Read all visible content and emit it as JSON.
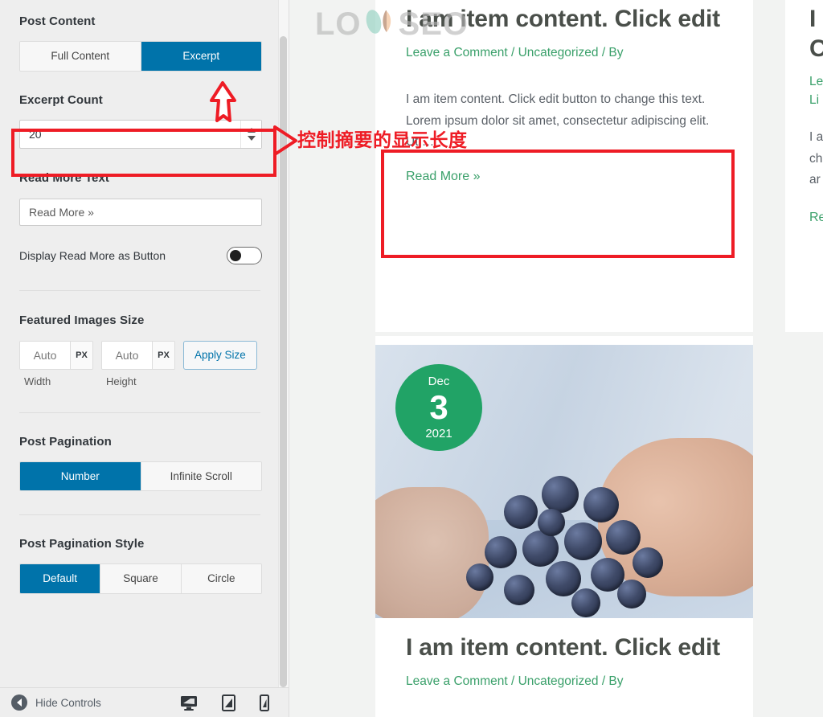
{
  "sidebar": {
    "post_content": {
      "title": "Post Content",
      "options": [
        {
          "label": "Full Content",
          "active": false
        },
        {
          "label": "Excerpt",
          "active": true
        }
      ]
    },
    "excerpt_count": {
      "title": "Excerpt Count",
      "value": "20"
    },
    "read_more_text": {
      "title": "Read More Text",
      "value": "Read More »",
      "placeholder": "Read More »"
    },
    "display_read_more_as_button": {
      "label": "Display Read More as Button",
      "state": "off"
    },
    "featured_images_size": {
      "title": "Featured Images Size",
      "width": {
        "value": "Auto",
        "unit": "PX",
        "caption": "Width"
      },
      "height": {
        "value": "Auto",
        "unit": "PX",
        "caption": "Height"
      },
      "apply_label": "Apply Size"
    },
    "post_pagination": {
      "title": "Post Pagination",
      "options": [
        {
          "label": "Number",
          "active": true
        },
        {
          "label": "Infinite Scroll",
          "active": false
        }
      ]
    },
    "post_pagination_style": {
      "title": "Post Pagination Style",
      "options": [
        {
          "label": "Default",
          "active": true
        },
        {
          "label": "Square",
          "active": false
        },
        {
          "label": "Circle",
          "active": false
        }
      ]
    },
    "footer": {
      "hide_controls_label": "Hide Controls",
      "devices": [
        "desktop-icon",
        "tablet-icon",
        "mobile-icon"
      ],
      "active_device": "desktop-icon"
    }
  },
  "preview": {
    "watermark": "LOYSEO",
    "posts": [
      {
        "title": "I am item content. Click edit",
        "meta": "Leave a Comment / Uncategorized / By",
        "excerpt": "I am item content. Click edit button to change this text. Lorem ipsum dolor sit amet, consectetur adipiscing elit. Ut …",
        "read_more": "Read More »"
      },
      {
        "date": {
          "month": "Dec",
          "day": "3",
          "year": "2021"
        },
        "title": "I am item content. Click edit",
        "meta": "Leave a Comment / Uncategorized / By"
      }
    ],
    "right_column": {
      "title_line1": "I",
      "title_line2": "C",
      "meta_line1": "Le",
      "meta_line2": "Li",
      "excerpt_line1": "I a",
      "excerpt_line2": "ch",
      "excerpt_line3": "ar",
      "read_more": "Re"
    }
  },
  "annotations": {
    "note_text": "控制摘要的显示长度"
  },
  "colors": {
    "accent_blue": "#0073aa",
    "annotation_red": "#ee1c25",
    "link_green": "#3aa06a",
    "badge_green": "#21a366",
    "sidebar_bg": "#eeeeee",
    "preview_bg": "#f2f3f2"
  }
}
